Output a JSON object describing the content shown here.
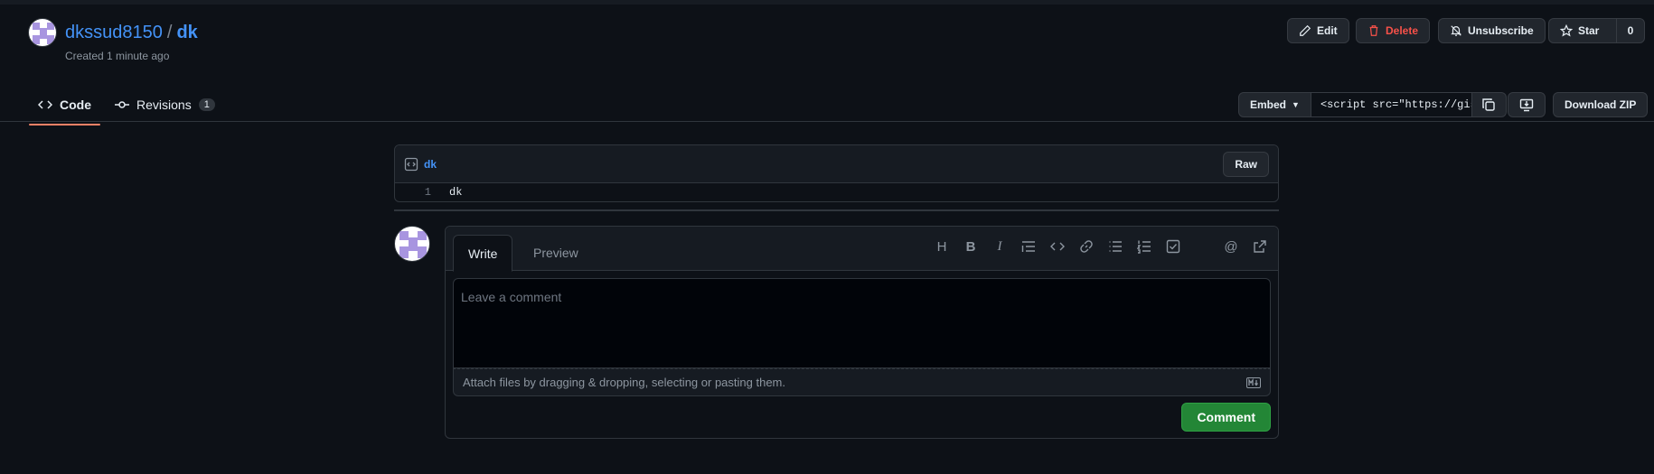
{
  "header": {
    "owner": "dkssud8150",
    "separator": "/",
    "gist_name": "dk",
    "created": "Created 1 minute ago",
    "actions": {
      "edit": "Edit",
      "delete": "Delete",
      "unsubscribe": "Unsubscribe",
      "star": "Star",
      "star_count": "0"
    }
  },
  "tabs": [
    {
      "label": "Code",
      "selected": true
    },
    {
      "label": "Revisions",
      "count": "1"
    }
  ],
  "embed": {
    "label": "Embed",
    "value": "<script src=\"https://gist",
    "download": "Download ZIP"
  },
  "file": {
    "name": "dk",
    "raw_label": "Raw",
    "lines": [
      {
        "num": "1",
        "code": "dk"
      }
    ]
  },
  "comment": {
    "write_tab": "Write",
    "preview_tab": "Preview",
    "placeholder": "Leave a comment",
    "attach_text": "Attach files by dragging & dropping, selecting or pasting them.",
    "submit": "Comment"
  },
  "colors": {
    "background": "#0d1117",
    "link": "#4493f8",
    "danger": "#f85149",
    "primary_button": "#238636",
    "tab_underline": "#f78166"
  }
}
